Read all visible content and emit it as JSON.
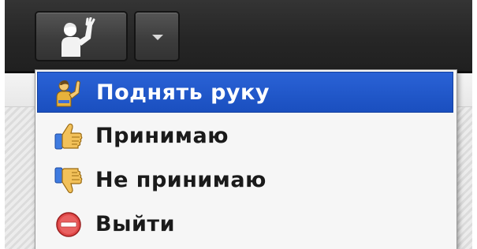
{
  "toolbar": {
    "status_button": {
      "icon": "raised-hand-person-icon"
    },
    "dropdown_button": {
      "icon": "chevron-down-icon"
    }
  },
  "status_menu": {
    "items": [
      {
        "label": "Поднять руку",
        "icon": "raised-hand-person-icon",
        "selected": true
      },
      {
        "label": "Принимаю",
        "icon": "thumbs-up-icon",
        "selected": false
      },
      {
        "label": "Не принимаю",
        "icon": "thumbs-down-icon",
        "selected": false
      },
      {
        "label": "Выйти",
        "icon": "leave-minus-icon",
        "selected": false
      }
    ]
  },
  "colors": {
    "selected_bg": "#1f56c9",
    "toolbar_bg": "#2a2a2a",
    "menu_bg": "#f6f6f6"
  }
}
